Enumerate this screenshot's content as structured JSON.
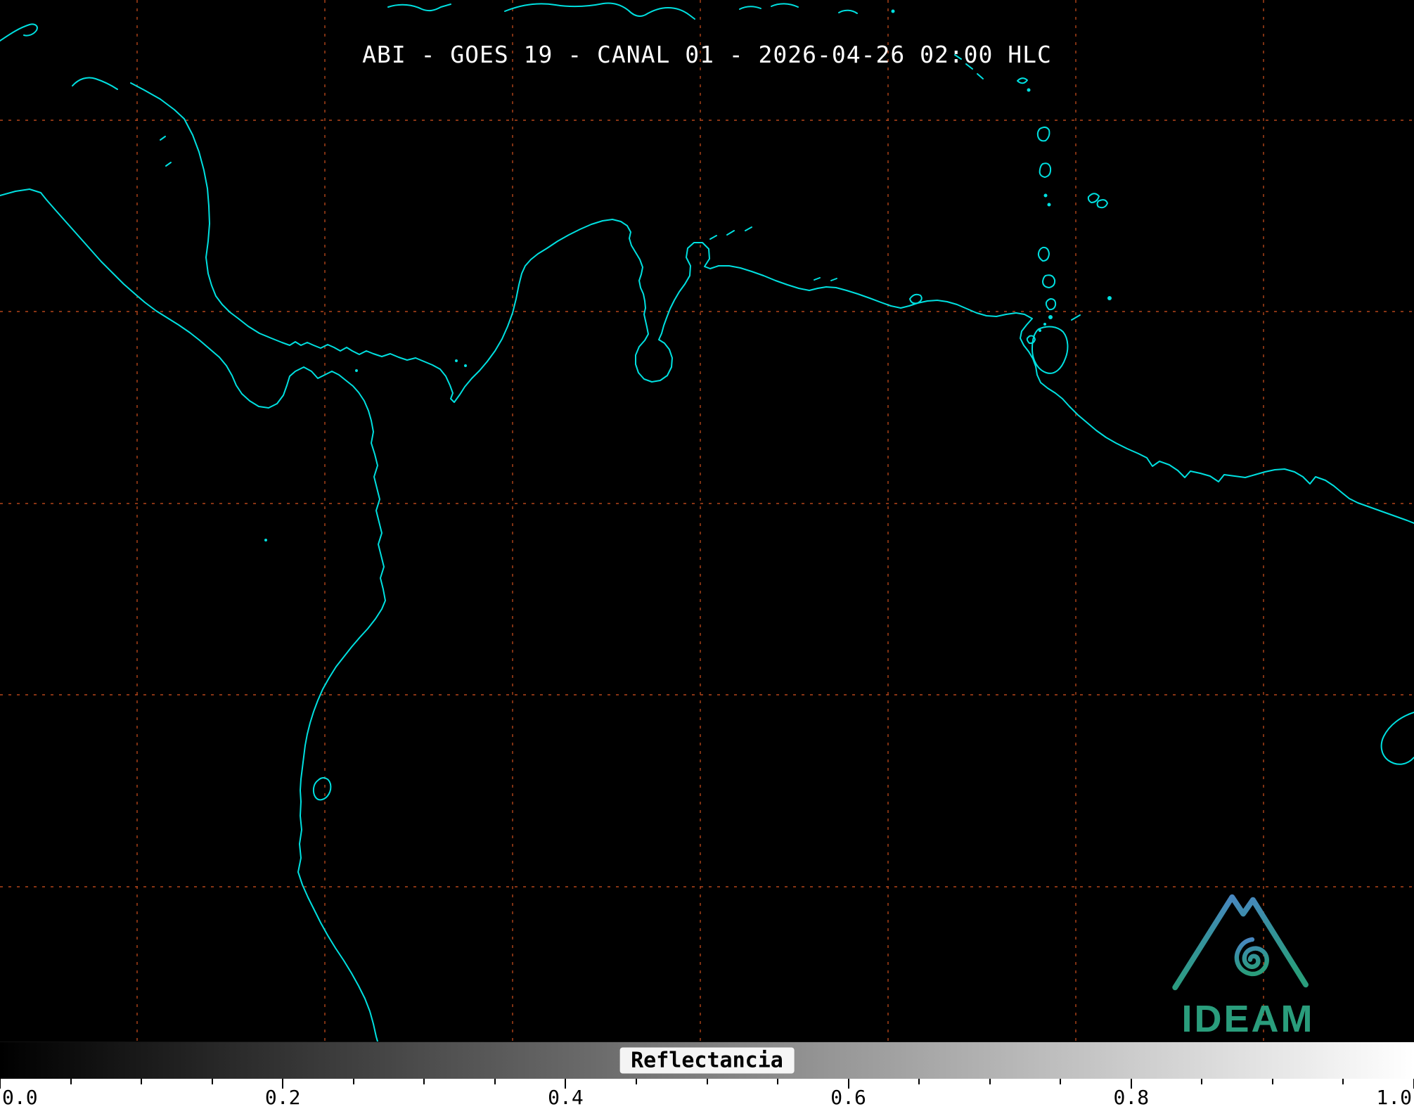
{
  "header": {
    "title": "ABI - GOES 19 - CANAL 01 - 2026-04-26 02:00 HLC"
  },
  "map": {
    "background_color": "#000000",
    "coastline_color": "#00e0e0",
    "grid_color": "#bf4a1d",
    "grid_style": "dashed"
  },
  "colorbar": {
    "label": "Reflectancia",
    "min": 0.0,
    "max": 1.0,
    "gradient": [
      "#000000",
      "#ffffff"
    ],
    "ticks": [
      {
        "value": 0.0,
        "label": "0.0"
      },
      {
        "value": 0.2,
        "label": "0.2"
      },
      {
        "value": 0.4,
        "label": "0.4"
      },
      {
        "value": 0.6,
        "label": "0.6"
      },
      {
        "value": 0.8,
        "label": "0.8"
      },
      {
        "value": 1.0,
        "label": "1.0"
      }
    ]
  },
  "logo": {
    "text": "IDEAM",
    "icon": "mountain-hurricane-spiral-icon",
    "color": "#2a9d7c",
    "gradient_top": "#4d85c9",
    "gradient_bottom": "#2a9d7c"
  }
}
